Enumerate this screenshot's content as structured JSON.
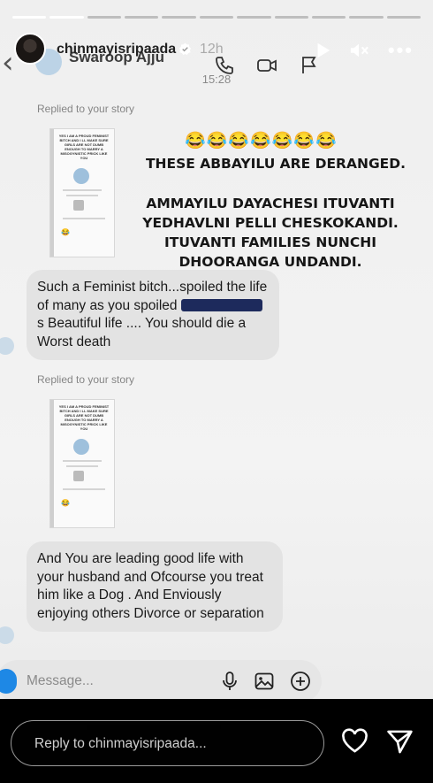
{
  "story": {
    "username": "chinmayisripaada",
    "time_ago": "12h",
    "more_label": "•••",
    "progress": {
      "segments": 11,
      "completed": 2
    }
  },
  "chat": {
    "contact_name": "Swaroop Ajju",
    "timestamp": "15:28",
    "replies": [
      {
        "label": "Replied to your story"
      },
      {
        "label": "Replied to your story"
      }
    ],
    "shared_story_text": {
      "emojis": "😂😂😂😂😂😂😂",
      "line1": "THESE ABBAYILU ARE DERANGED.",
      "line2": "AMMAYILU DAYACHESI ITUVANTI YEDHAVLNI PELLI CHESKOKANDI. ITUVANTI FAMILIES NUNCHI DHOORANGA UNDANDI."
    },
    "thumb_text": "YES I AM A PROUD FEMINIST BITCH AND I LL MAKE SURE GIRLS ARE NOT DUMB ENOUGH TO MARRY A MISOGYNISTIC PRICK LIKE YOU",
    "messages": [
      {
        "text_before": "Such a Feminist bitch...spoiled the life of many as you spoiled ",
        "text_after": "s Beautiful life .... You should die a Worst death"
      },
      {
        "text": "And You are leading good life with your husband and Ofcourse you treat him like a Dog . And Enviously enjoying others Divorce or separation"
      }
    ],
    "message_placeholder": "Message..."
  },
  "reply_bar": {
    "placeholder": "Reply to chinmayisripaada..."
  },
  "colors": {
    "accent_blue": "#1e88e5",
    "bubble": "#e3e3e3",
    "redaction": "#1d2a5c"
  },
  "icons": [
    "back-icon",
    "phone-icon",
    "video-icon",
    "flag-icon",
    "verified-icon",
    "play-icon",
    "mute-icon",
    "camera-icon",
    "mic-icon",
    "gallery-icon",
    "add-icon",
    "heart-icon",
    "send-icon"
  ]
}
